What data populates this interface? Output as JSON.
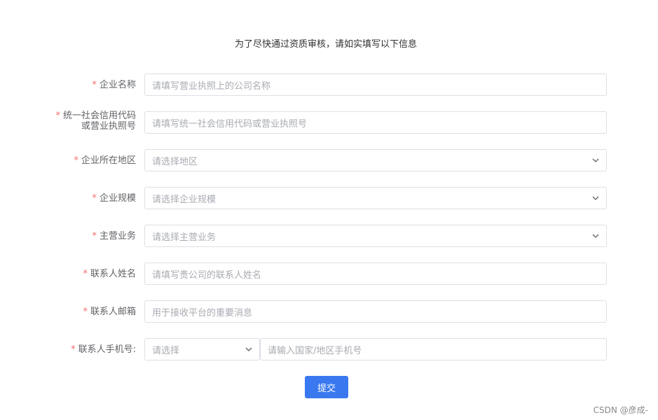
{
  "title": "为了尽快通过资质审核，请如实填写以下信息",
  "required_mark": "*",
  "fields": {
    "company_name": {
      "label": "企业名称",
      "placeholder": "请填写营业执照上的公司名称"
    },
    "credit_code": {
      "label_line1": "统一社会信用代码",
      "label_line2": "或营业执照号",
      "placeholder": "请填写统一社会信用代码或营业执照号"
    },
    "region": {
      "label": "企业所在地区",
      "placeholder": "请选择地区"
    },
    "scale": {
      "label": "企业规模",
      "placeholder": "请选择企业规模"
    },
    "business": {
      "label": "主营业务",
      "placeholder": "请选择主营业务"
    },
    "contact_name": {
      "label": "联系人姓名",
      "placeholder": "请填写贵公司的联系人姓名"
    },
    "contact_email": {
      "label": "联系人邮箱",
      "placeholder": "用于接收平台的重要消息"
    },
    "contact_phone": {
      "label": "联系人手机号:",
      "code_placeholder": "请选择",
      "placeholder": "请输入国家/地区手机号"
    }
  },
  "submit_label": "提交",
  "watermark": "CSDN @彦成-",
  "colors": {
    "accent": "#3a78f0",
    "required": "#f56c6c",
    "border": "#dcdfe6",
    "placeholder": "#a8abb2"
  }
}
